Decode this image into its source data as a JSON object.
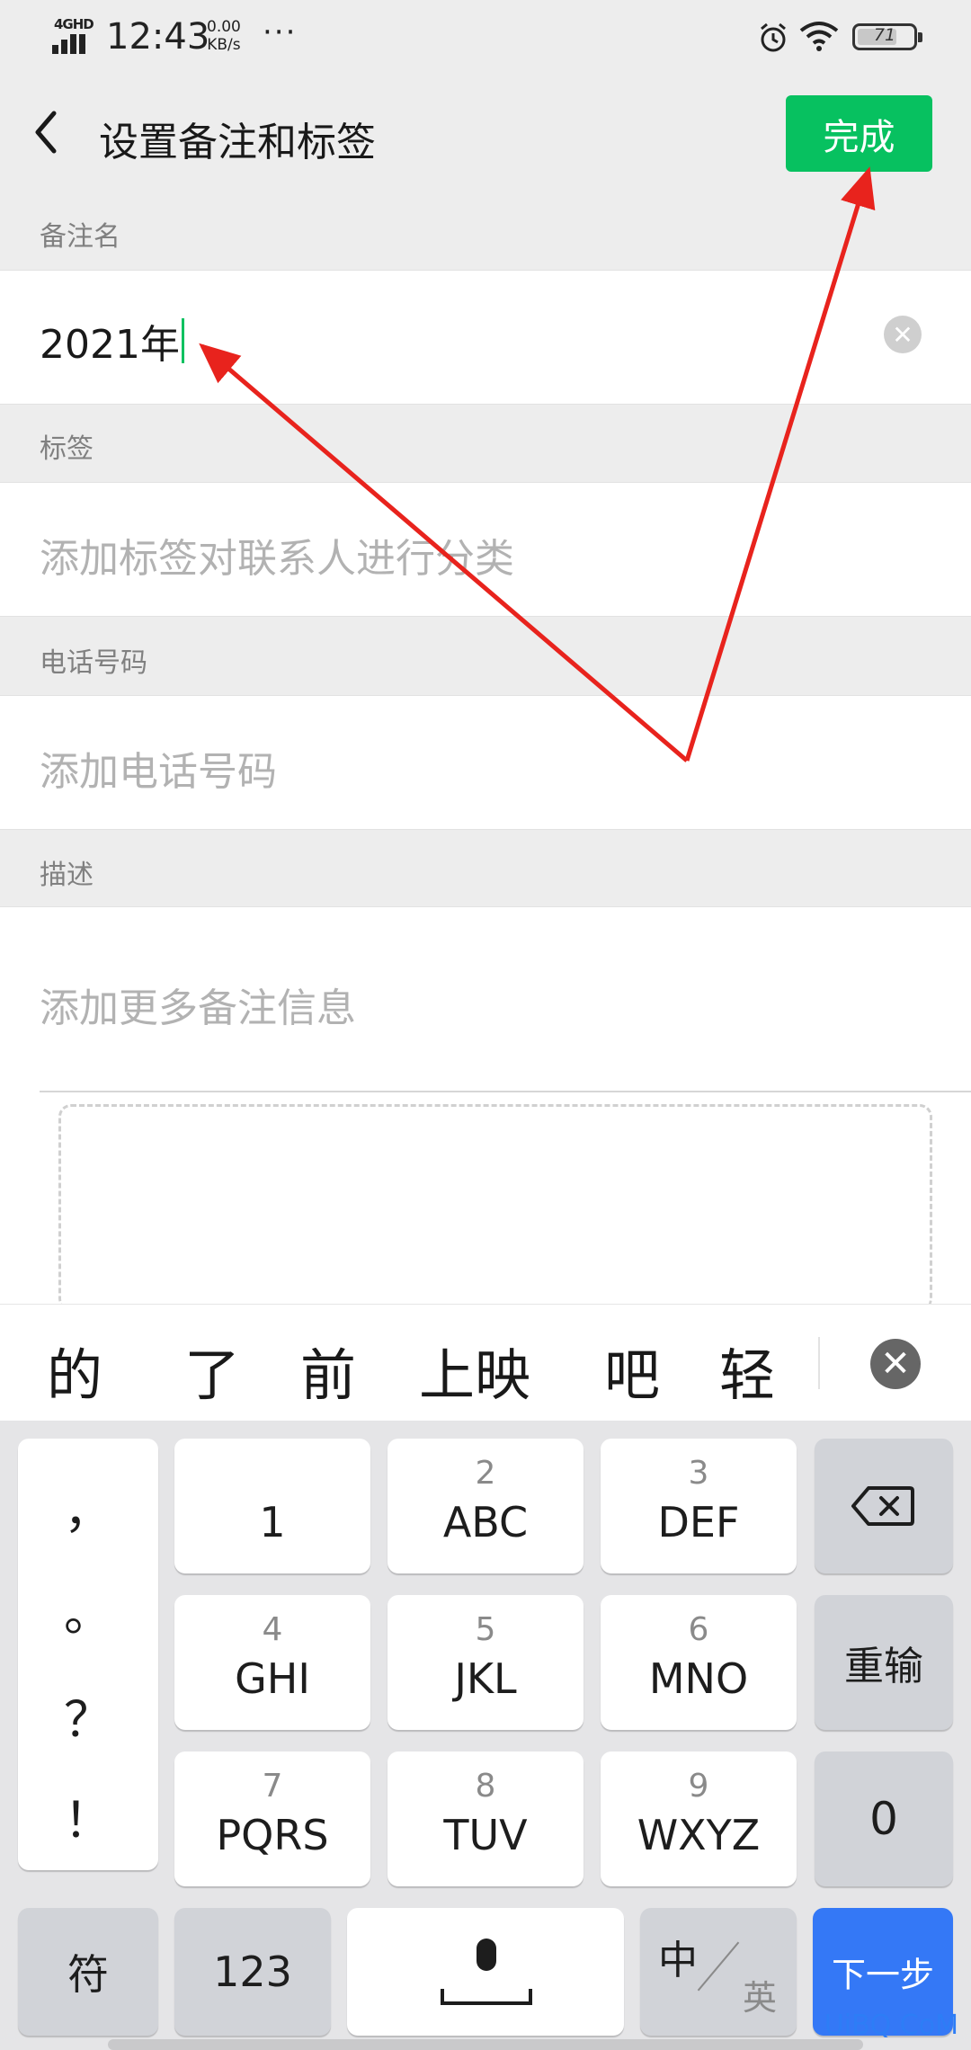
{
  "status_bar": {
    "network": "4GHD",
    "time": "12:43",
    "speed_value": "0.00",
    "speed_unit": "KB/s",
    "more": "···",
    "battery": "71"
  },
  "header": {
    "title": "设置备注和标签",
    "done_label": "完成"
  },
  "remark": {
    "label": "备注名",
    "value": "2021年",
    "clear_icon": "✕"
  },
  "tags": {
    "label": "标签",
    "placeholder": "添加标签对联系人进行分类"
  },
  "phone": {
    "label": "电话号码",
    "placeholder": "添加电话号码"
  },
  "description": {
    "label": "描述",
    "placeholder": "添加更多备注信息"
  },
  "candidates": {
    "items": [
      "的",
      "了",
      "前",
      "上映",
      "吧",
      "轻"
    ],
    "close_icon": "✕"
  },
  "keyboard": {
    "punctuation": [
      "，",
      "。",
      "？",
      "！"
    ],
    "keys": [
      {
        "sub": "",
        "main": "1"
      },
      {
        "sub": "2",
        "main": "ABC"
      },
      {
        "sub": "3",
        "main": "DEF"
      },
      {
        "sub": "4",
        "main": "GHI"
      },
      {
        "sub": "5",
        "main": "JKL"
      },
      {
        "sub": "6",
        "main": "MNO"
      },
      {
        "sub": "7",
        "main": "PQRS"
      },
      {
        "sub": "8",
        "main": "TUV"
      },
      {
        "sub": "9",
        "main": "WXYZ"
      }
    ],
    "reset_label": "重输",
    "zero_label": "0",
    "symbol_label": "符",
    "num_label": "123",
    "lang_zh": "中",
    "lang_en": "英",
    "next_label": "下一步"
  },
  "watermark": "UiBQ.CoM",
  "colors": {
    "accent": "#07c160",
    "keyboard_action": "#3478f6",
    "annotation_arrow": "#e8231d"
  }
}
